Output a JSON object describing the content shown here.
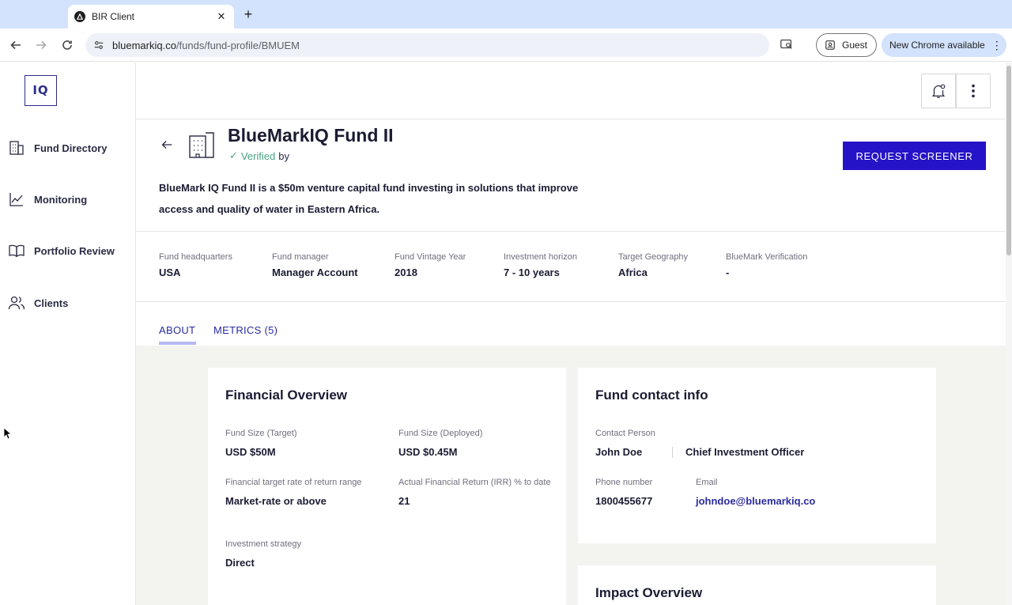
{
  "browser": {
    "tab_title": "BIR Client",
    "url_host": "bluemarkiq.co",
    "url_path": "/funds/fund-profile/BMUEM",
    "guest_label": "Guest",
    "update_label": "New Chrome available"
  },
  "sidebar": {
    "logo": "IQ",
    "items": [
      {
        "label": "Fund Directory",
        "icon": "building-icon"
      },
      {
        "label": "Monitoring",
        "icon": "chart-line-icon"
      },
      {
        "label": "Portfolio Review",
        "icon": "book-icon"
      },
      {
        "label": "Clients",
        "icon": "users-icon"
      }
    ]
  },
  "fund": {
    "title": "BlueMarkIQ Fund II",
    "verified_label": "Verified",
    "verified_by": "by",
    "request_button": "REQUEST SCREENER",
    "description": "BlueMark IQ Fund II is a $50m venture capital fund investing in solutions that improve access and quality of water in Eastern Africa."
  },
  "meta": [
    {
      "label": "Fund headquarters",
      "value": "USA"
    },
    {
      "label": "Fund manager",
      "value": "Manager Account"
    },
    {
      "label": "Fund Vintage Year",
      "value": "2018"
    },
    {
      "label": "Investment horizon",
      "value": "7 - 10 years"
    },
    {
      "label": "Target Geography",
      "value": "Africa"
    },
    {
      "label": "BlueMark Verification",
      "value": "-"
    }
  ],
  "tabs": [
    {
      "label": "ABOUT",
      "active": true
    },
    {
      "label": "METRICS (5)",
      "active": false
    }
  ],
  "financial": {
    "title": "Financial Overview",
    "fields": [
      {
        "label": "Fund Size (Target)",
        "value": "USD $50M"
      },
      {
        "label": "Fund Size (Deployed)",
        "value": "USD $0.45M"
      },
      {
        "label": "Financial target rate of return range",
        "value": "Market-rate or above"
      },
      {
        "label": "Actual Financial Return (IRR) % to date",
        "value": "21"
      },
      {
        "label": "Investment strategy",
        "value": "Direct"
      }
    ]
  },
  "contact": {
    "title": "Fund contact info",
    "contact_label": "Contact Person",
    "contact_name": "John Doe",
    "contact_role": "Chief Investment Officer",
    "phone_label": "Phone number",
    "phone_value": "1800455677",
    "email_label": "Email",
    "email_value": "johndoe@bluemarkiq.co"
  },
  "impact": {
    "title": "Impact Overview"
  },
  "colors": {
    "primary": "#2513c7",
    "verified": "#4aa386",
    "tab_accent": "#b6b9f0",
    "content_bg": "#f3f3ef"
  }
}
